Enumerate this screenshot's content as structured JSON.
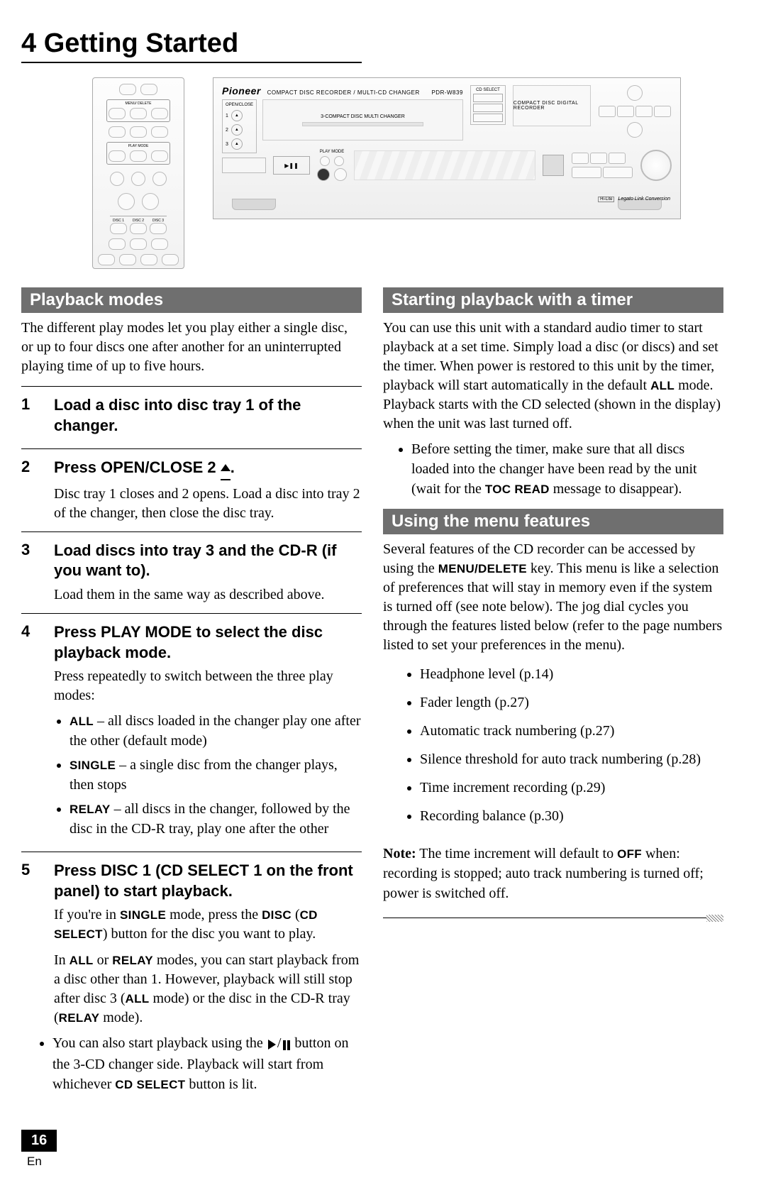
{
  "chapter": {
    "title": "4 Getting Started"
  },
  "diagram": {
    "remote": {
      "menu_delete": "MENU/\nDELETE",
      "play_mode": "PLAY\nMODE",
      "disc1": "DISC 1",
      "disc2": "DISC 2",
      "disc3": "DISC 3"
    },
    "panel": {
      "brand": "Pioneer",
      "subtitle": "COMPACT DISC RECORDER / MULTI-CD CHANGER",
      "model": "PDR-W839",
      "open_close_label": "OPEN/CLOSE",
      "changer_label": "3-COMPACT DISC MULTI CHANGER",
      "cd_select_label": "CD SELECT",
      "recorder_label": "COMPACT DISC DIGITAL RECORDER",
      "play_mode_label": "PLAY MODE",
      "legato": "Legato Link Conversion",
      "hilite": "Hi-Lite"
    }
  },
  "left": {
    "section_title": "Playback modes",
    "intro": "The different play modes let you play either a single disc, or up to four discs one after another for an uninterrupted playing time of up to five hours.",
    "steps": [
      {
        "num": "1",
        "bold": "Load a disc into disc tray 1 of the changer."
      },
      {
        "num": "2",
        "bold": "Press OPEN/CLOSE 2 ",
        "desc": "Disc tray 1 closes and 2 opens. Load a disc into tray 2 of the changer, then close the disc tray."
      },
      {
        "num": "3",
        "bold": "Load discs into tray 3 and the CD-R (if you want to).",
        "desc": "Load them in the same way as described above."
      },
      {
        "num": "4",
        "bold": "Press PLAY MODE to select the disc playback mode.",
        "desc": "Press repeatedly to switch between the three play modes:",
        "bullets": [
          {
            "b": "ALL",
            "t": " – all discs loaded in the changer play one after the other (default mode)"
          },
          {
            "b": "SINGLE",
            "t": " – a single disc from the changer plays, then stops"
          },
          {
            "b": "RELAY",
            "t": " – all discs in the changer, followed by the disc in the CD-R tray, play one after the other"
          }
        ]
      },
      {
        "num": "5",
        "bold": "Press DISC 1 (CD SELECT 1 on the front panel) to start playback.",
        "desc_parts": {
          "p1a": "If you're in ",
          "p1b": "SINGLE",
          "p1c": " mode, press the ",
          "p1d": "DISC",
          "p1e": " (",
          "p1f": "CD SELECT",
          "p1g": ") button for the disc you want to play.",
          "p2a": "In ",
          "p2b": "ALL",
          "p2c": " or ",
          "p2d": "RELAY",
          "p2e": " modes, you can start playback from a disc other than 1. However, playback will still stop after disc 3 (",
          "p2f": "ALL",
          "p2g": " mode) or the disc in the CD-R tray (",
          "p2h": "RELAY",
          "p2i": " mode)."
        },
        "bullet2a": "You can also start playback using the ",
        "bullet2b": " button on the 3-CD changer side. Playback will start from whichever ",
        "bullet2c": "CD SELECT",
        "bullet2d": " button is lit."
      }
    ]
  },
  "right": {
    "s1_title": "Starting playback with a timer",
    "s1_body_a": "You can use this unit with a standard audio timer to start playback at a set time. Simply load a disc (or discs) and set the timer. When power is restored to this unit by the timer, playback will start automatically in the default ",
    "s1_body_all": "ALL",
    "s1_body_b": " mode. Playback starts with the CD selected (shown in the display) when the unit was last turned off.",
    "s1_bullet_a": "Before setting the timer, make sure that all discs loaded into the changer have been read by the unit (wait for the ",
    "s1_bullet_b": "TOC READ",
    "s1_bullet_c": " message to disappear).",
    "s2_title": "Using the menu features",
    "s2_body_a": "Several features of the CD recorder can be accessed by using the ",
    "s2_body_key": "MENU/DELETE",
    "s2_body_b": " key. This menu is like a selection of preferences that will stay in memory even if the system is turned off (see note below). The jog dial cycles you through the features listed below (refer to the page numbers listed to set your preferences in the menu).",
    "menu": [
      "Headphone level (p.14)",
      "Fader length (p.27)",
      "Automatic track numbering (p.27)",
      "Silence threshold for auto track numbering (p.28)",
      "Time increment recording (p.29)",
      "Recording balance (p.30)"
    ],
    "note_bold": "Note:",
    "note_a": " The time increment will default to ",
    "note_off": "OFF",
    "note_b": " when: recording is stopped; auto track numbering is turned off; power is switched off."
  },
  "footer": {
    "page": "16",
    "lang": "En"
  }
}
